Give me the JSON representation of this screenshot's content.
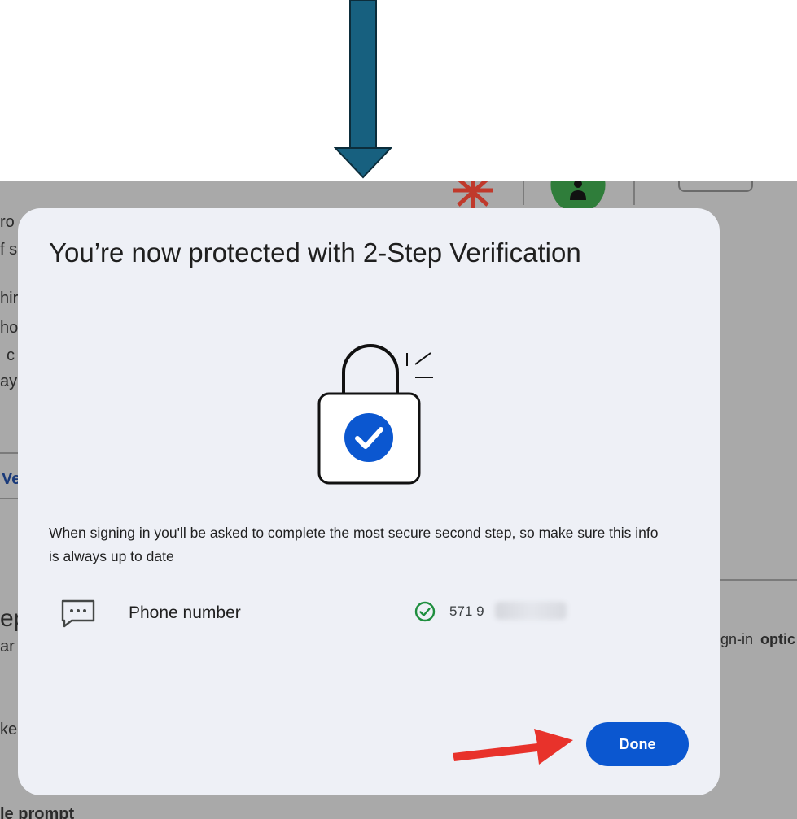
{
  "colors": {
    "annotation_arrow": "#17607f",
    "annotation_arrow_red": "#e8322b",
    "primary": "#0b57d0",
    "success": "#1e8e3e",
    "dialog_bg": "#eef0f6",
    "scrim": "#a9a9a9"
  },
  "background_page": {
    "fragments": [
      "ro",
      "f s",
      "hir",
      "ho",
      "c",
      "ay",
      "Ve",
      "ep",
      "ar",
      "ke",
      "le prompt",
      "gn-in",
      "optic"
    ]
  },
  "dialog": {
    "title": "You’re now protected with 2-Step Verification",
    "illustration": "lock-check-icon",
    "description": "When signing in you'll be asked to complete the most secure second step, so make sure this info is always up to date",
    "methods": [
      {
        "icon": "message-icon",
        "label": "Phone number",
        "status_icon": "check-circle-icon",
        "value": "571 9"
      }
    ],
    "done_label": "Done"
  }
}
